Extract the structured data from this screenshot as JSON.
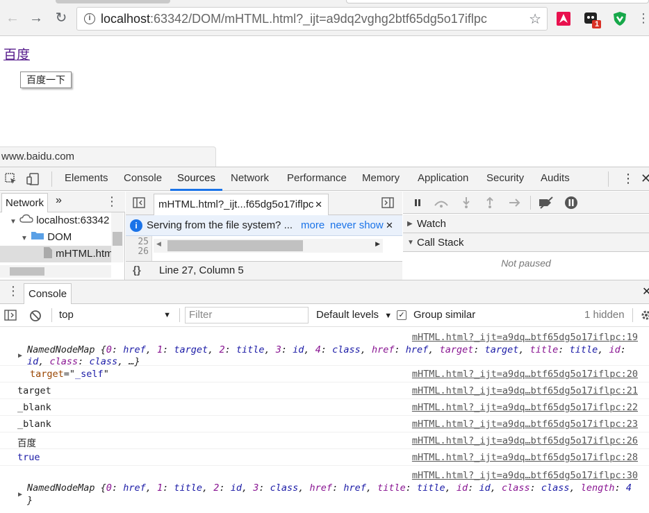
{
  "browser": {
    "url_host": "localhost",
    "url_rest": ":63342/DOM/mHTML.html?_ijt=a9dq2vghg2btf65dg5o17iflpc",
    "ext_badge": "1"
  },
  "page": {
    "link_text": "百度",
    "button_label": "百度一下",
    "status_url": "www.baidu.com"
  },
  "devtools": {
    "tabs": [
      "Elements",
      "Console",
      "Sources",
      "Network",
      "Performance",
      "Memory",
      "Application",
      "Security",
      "Audits"
    ],
    "active_tab": "Sources",
    "navigator": {
      "tab": "Network",
      "more": "»",
      "tree": [
        {
          "label": "localhost:63342"
        },
        {
          "label": "DOM"
        },
        {
          "label": "mHTML.htm"
        }
      ]
    },
    "editor": {
      "file_tab": "mHTML.html?_ijt...f65dg5o17iflpc",
      "info_text": "Serving from the file system? ...",
      "info_more": "more",
      "info_never": "never show",
      "line_numbers": [
        "25",
        "26"
      ],
      "position": "Line 27, Column 5"
    },
    "debugger": {
      "watch": "Watch",
      "call_stack": "Call Stack",
      "not_paused": "Not paused"
    }
  },
  "console": {
    "drawer_tab": "Console",
    "context": "top",
    "filter_placeholder": "Filter",
    "levels": "Default levels",
    "group_similar": "Group similar",
    "hidden": "1 hidden",
    "messages": [
      {
        "source": "mHTML.html?_ijt=a9dq…btf65dg5o17iflpc:19"
      },
      {
        "source": "mHTML.html?_ijt=a9dq…btf65dg5o17iflpc:20",
        "attr_name": "target",
        "attr_eq": "=\"",
        "attr_value": "_self",
        "attr_end": "\""
      },
      {
        "source": "mHTML.html?_ijt=a9dq…btf65dg5o17iflpc:21",
        "text": "target"
      },
      {
        "source": "mHTML.html?_ijt=a9dq…btf65dg5o17iflpc:22",
        "text": "_blank"
      },
      {
        "source": "mHTML.html?_ijt=a9dq…btf65dg5o17iflpc:23",
        "text": "_blank"
      },
      {
        "source": "mHTML.html?_ijt=a9dq…btf65dg5o17iflpc:26",
        "text": "百度"
      },
      {
        "source": "mHTML.html?_ijt=a9dq…btf65dg5o17iflpc:28",
        "text": "true"
      },
      {
        "source": "mHTML.html?_ijt=a9dq…btf65dg5o17iflpc:30"
      }
    ]
  }
}
